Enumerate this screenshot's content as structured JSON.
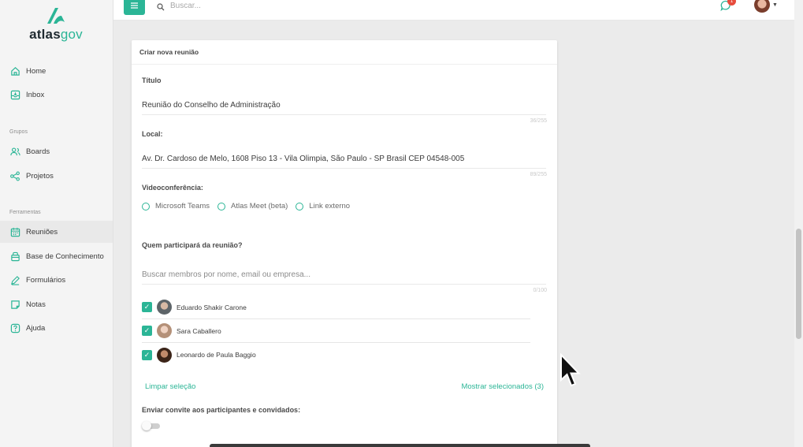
{
  "brand": {
    "name_part1": "atlas",
    "name_part2": "gov",
    "accent": "#2bb596"
  },
  "sidebar": {
    "items": [
      {
        "label": "Home",
        "icon": "home-icon"
      },
      {
        "label": "Inbox",
        "icon": "inbox-icon"
      }
    ],
    "group_label": "Grupos",
    "group_items": [
      {
        "label": "Boards",
        "icon": "users-icon"
      },
      {
        "label": "Projetos",
        "icon": "share-icon"
      }
    ],
    "tools_label": "Ferramentas",
    "tool_items": [
      {
        "label": "Reuniões",
        "icon": "calendar-icon",
        "active": true
      },
      {
        "label": "Base de Conhecimento",
        "icon": "box-icon"
      },
      {
        "label": "Formulários",
        "icon": "pen-icon"
      },
      {
        "label": "Notas",
        "icon": "note-icon"
      },
      {
        "label": "Ajuda",
        "icon": "help-icon"
      }
    ]
  },
  "topbar": {
    "search_placeholder": "Buscar...",
    "notification_count": "1"
  },
  "form": {
    "header": "Criar nova reunião",
    "title_label": "Título",
    "title_value": "Reunião do Conselho de Administração",
    "title_counter": "36/255",
    "location_label": "Local:",
    "location_value": "Av. Dr. Cardoso de Melo, 1608 Piso 13 - Vila Olimpia, São Paulo - SP Brasil CEP 04548-005",
    "location_counter": "89/255",
    "video_label": "Videoconferência:",
    "video_options": [
      "Microsoft Teams",
      "Atlas Meet (beta)",
      "Link externo"
    ],
    "participants_label": "Quem participará da reunião?",
    "participants_placeholder": "Buscar membros por nome, email ou empresa...",
    "participants_counter": "0/100",
    "members": [
      {
        "name": "Eduardo Shakir Carone",
        "checked": true
      },
      {
        "name": "Sara Caballero",
        "checked": true
      },
      {
        "name": "Leonardo de Paula Baggio",
        "checked": true
      }
    ],
    "clear_selection": "Limpar seleção",
    "show_selected": "Mostrar selecionados (3)",
    "invite_label": "Enviar convite aos participantes e convidados:",
    "invite_enabled": false
  }
}
